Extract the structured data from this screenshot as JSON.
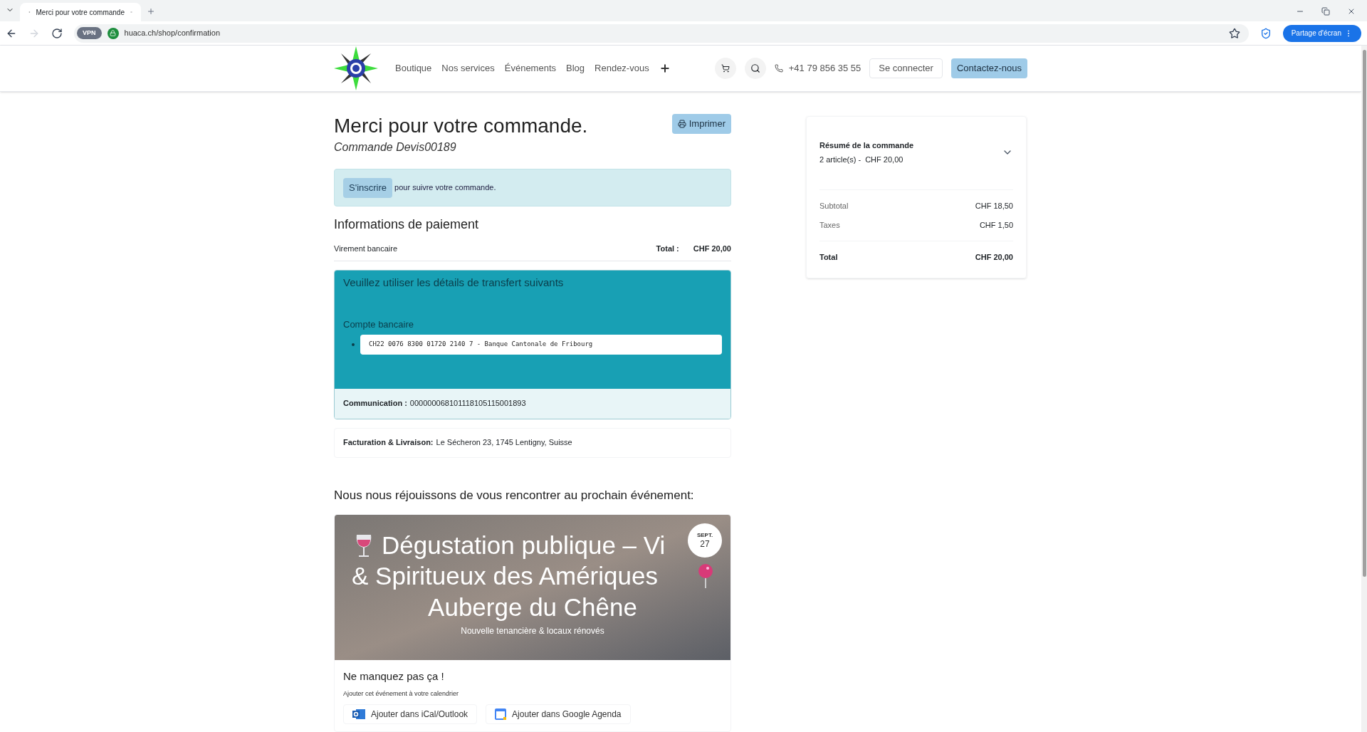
{
  "browser": {
    "tab_title": "Merci pour votre commande",
    "url": "huaca.ch/shop/confirmation",
    "vpn_label": "VPN",
    "share_button": "Partage d'écran"
  },
  "header": {
    "nav": [
      "Boutique",
      "Nos services",
      "Événements",
      "Blog",
      "Rendez-vous"
    ],
    "phone": "+41 79 856 35 55",
    "login": "Se connecter",
    "contact": "Contactez-nous"
  },
  "confirmation": {
    "title": "Merci pour votre commande.",
    "order": "Commande Devis00189",
    "print_button": "Imprimer",
    "signup_button": "S'inscrire",
    "signup_text": "pour suivre votre commande."
  },
  "payment": {
    "heading": "Informations de paiement",
    "method": "Virement bancaire",
    "total_label": "Total :",
    "total_value": "CHF 20,00",
    "transfer": {
      "heading": "Veuillez utiliser les détails de transfert suivants",
      "account_label": "Compte bancaire",
      "accounts": [
        "CH22 0076 8300 01720 2140 7 - Banque Cantonale de Fribourg"
      ],
      "communication_label": "Communication :",
      "communication_value": "000000068101118105115001893"
    },
    "billing_label": "Facturation & Livraison:",
    "billing_value": "Le Sécheron 23, 1745 Lentigny, Suisse"
  },
  "event": {
    "heading": "Nous nous réjouissons de vous rencontrer au prochain événement:",
    "title_lines": [
      "Dégustation publique – Vi",
      "& Spiritueux des Amériques",
      "Auberge du Chêne"
    ],
    "subtitle": "Nouvelle tenancière & locaux rénovés",
    "month": "SEPT.",
    "day": "27",
    "cta": "Ne manquez pas ça !",
    "calendar_hint": "Ajouter cet événement à votre calendrier",
    "calendar_buttons": [
      {
        "kind": "outlook",
        "label": "Ajouter dans iCal/Outlook"
      },
      {
        "kind": "google",
        "label": "Ajouter dans Google Agenda"
      }
    ]
  },
  "summary": {
    "title": "Résumé de la commande",
    "items": "2 article(s) -  CHF 20,00",
    "expanded": false,
    "rows": [
      {
        "label": "Subtotal",
        "value": "CHF 18,50"
      },
      {
        "label": "Taxes",
        "value": "CHF 1,50"
      }
    ],
    "total_label": "Total",
    "total_value": "CHF 20,00"
  }
}
